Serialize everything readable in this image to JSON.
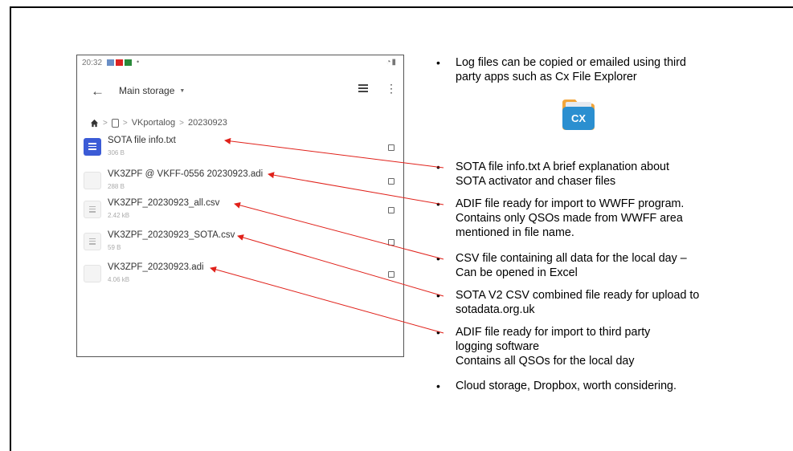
{
  "phone": {
    "status_time": "20:32",
    "storage_title": "Main storage",
    "breadcrumb": [
      "VKportalog",
      "20230923"
    ],
    "files": [
      {
        "name": "SOTA file info.txt",
        "size": "306 B",
        "icon": "text-document-icon"
      },
      {
        "name": "VK3ZPF @ VKFF-0556 20230923.adi",
        "size": "288 B",
        "icon": "blank-file-icon"
      },
      {
        "name": "VK3ZPF_20230923_all.csv",
        "size": "2.42 kB",
        "icon": "document-icon"
      },
      {
        "name": "VK3ZPF_20230923_SOTA.csv",
        "size": "59 B",
        "icon": "document-icon"
      },
      {
        "name": "VK3ZPF_20230923.adi",
        "size": "4.06 kB",
        "icon": "blank-file-icon"
      }
    ]
  },
  "bullets": {
    "b1": [
      "Log files can be copied or emailed using third",
      "party apps such as Cx File Explorer"
    ],
    "b2": [
      "SOTA file info.txt A brief explanation about",
      "SOTA activator and chaser files"
    ],
    "b3": [
      "ADIF file ready for import to WWFF program.",
      "Contains only QSOs made from WWFF area",
      "mentioned in file name."
    ],
    "b4": [
      "CSV file containing all data for the local day –",
      "Can be opened in Excel"
    ],
    "b5": [
      "SOTA V2 CSV combined file ready for upload to",
      "sotadata.org.uk"
    ],
    "b6": [
      "ADIF file ready for import to third party",
      "logging software",
      "Contains all QSOs for the local day"
    ],
    "b7": [
      "Cloud storage, Dropbox, worth considering."
    ]
  },
  "logo": {
    "text": "CX",
    "icon": "cx-file-explorer-logo"
  },
  "colors": {
    "arrow": "#e0211a",
    "logo_folder": "#2b8fd0",
    "txt_icon": "#3b5bd6"
  }
}
